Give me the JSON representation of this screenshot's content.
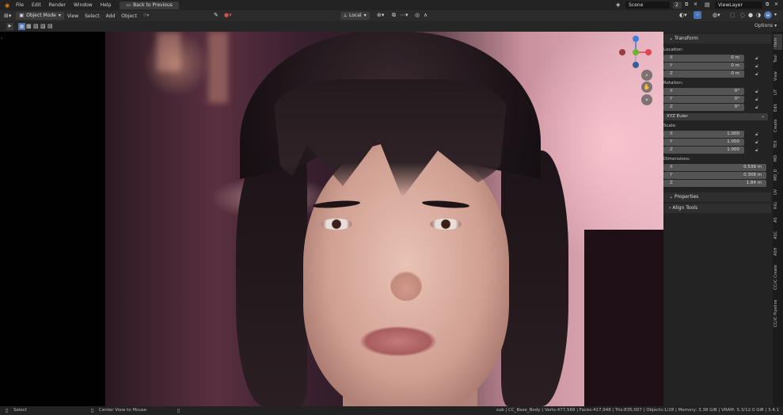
{
  "topbar": {
    "menus": [
      "File",
      "Edit",
      "Render",
      "Window",
      "Help"
    ],
    "back_label": "Back to Previous",
    "scene_name": "Scene",
    "scene_count": "2",
    "view_layer": "ViewLayer"
  },
  "header": {
    "mode": "Object Mode",
    "menus": [
      "View",
      "Select",
      "Add",
      "Object"
    ],
    "transform_orientation": "Local",
    "options_label": "Options"
  },
  "panel": {
    "transform_title": "Transform",
    "location_label": "Location:",
    "location": [
      {
        "axis": "X",
        "value": "0 m"
      },
      {
        "axis": "Y",
        "value": "0 m"
      },
      {
        "axis": "Z",
        "value": "0 m"
      }
    ],
    "rotation_label": "Rotation:",
    "rotation": [
      {
        "axis": "X",
        "value": "0°"
      },
      {
        "axis": "Y",
        "value": "0°"
      },
      {
        "axis": "Z",
        "value": "0°"
      }
    ],
    "rotation_mode": "XYZ Euler",
    "scale_label": "Scale:",
    "scale": [
      {
        "axis": "X",
        "value": "1.000"
      },
      {
        "axis": "Y",
        "value": "1.000"
      },
      {
        "axis": "Z",
        "value": "1.000"
      }
    ],
    "dimensions_label": "Dimensions:",
    "dimensions": [
      {
        "axis": "X",
        "value": "0.539 m"
      },
      {
        "axis": "Y",
        "value": "0.308 m"
      },
      {
        "axis": "Z",
        "value": "1.84 m"
      }
    ],
    "properties_title": "Properties",
    "align_title": "Align Tools"
  },
  "tabs": [
    "Item",
    "Tool",
    "View",
    "LIT",
    "Edit",
    "Create",
    "TEX",
    "MD",
    "MD_D",
    "UV",
    "RIG",
    "AS",
    "ASC",
    "ASH",
    "CC/iC Create",
    "CC/iC Pipeline"
  ],
  "status": {
    "select_label": "Select",
    "center_label": "Center View to Mouse",
    "stats": "sub | CC_Base_Body | Verts:477,568 | Faces:417,948 | Tris:835,007 | Objects:1/28 | Memory: 3.38 GiB | VRAM: 5.3/12.0 GiB | 3.4.1"
  },
  "colors": {
    "x_axis": "#e2454f",
    "y_axis": "#6db52f",
    "z_axis": "#3f7fd6",
    "accent": "#4772b3"
  }
}
